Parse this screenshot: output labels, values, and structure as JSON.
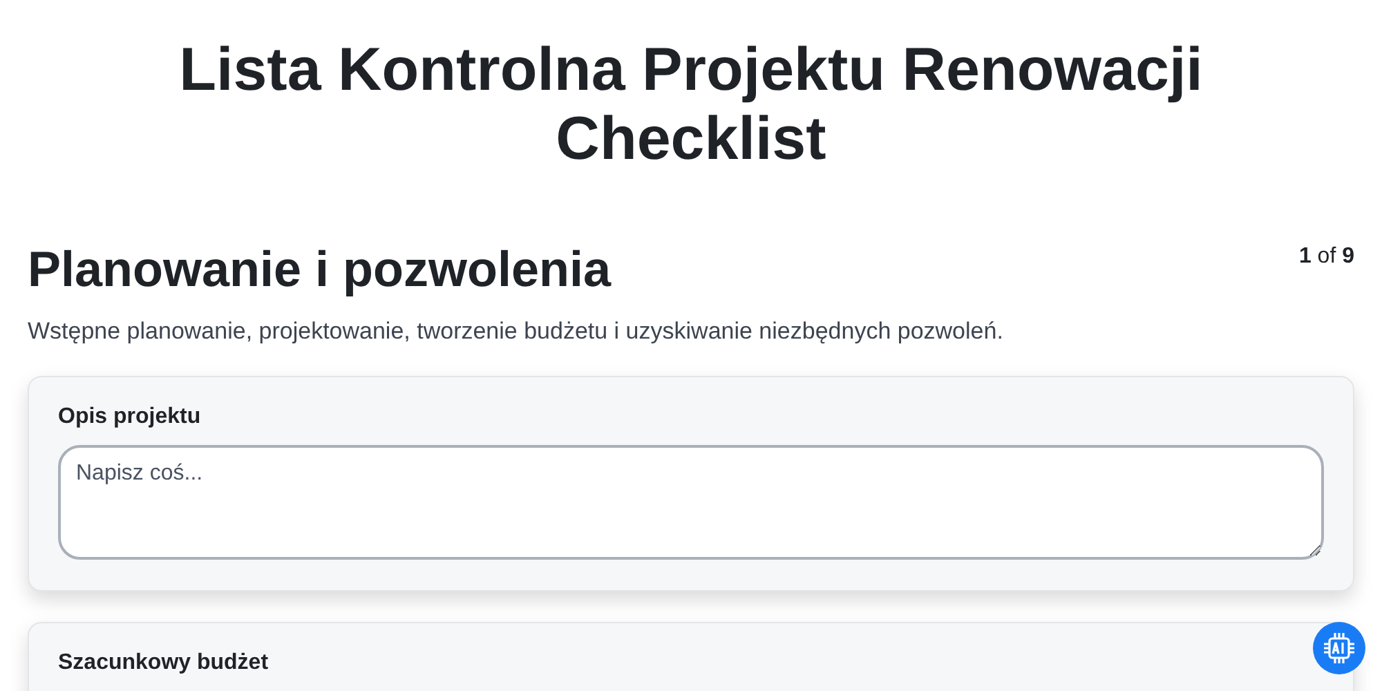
{
  "title": "Lista Kontrolna Projektu Renowacji Checklist",
  "section": {
    "heading": "Planowanie i pozwolenia",
    "progress": "**1** of **9**",
    "description": "Wstępne planowanie, projektowanie, tworzenie budżetu i uzyskiwanie niezbędnych pozwoleń."
  },
  "fields": [
    {
      "label": "Opis projektu",
      "placeholder": "Napisz coś..."
    },
    {
      "label": "Szacunkowy budżet"
    }
  ]
}
